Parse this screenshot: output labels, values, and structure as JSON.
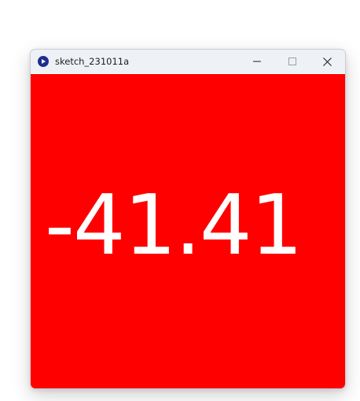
{
  "window": {
    "title": "sketch_231011a",
    "icon": "processing-app-icon",
    "controls": [
      "minimize-icon",
      "maximize-icon",
      "close-icon"
    ]
  },
  "canvas": {
    "background": "#ff0000",
    "text_color": "#ffffff",
    "value_text": "-41.41"
  }
}
